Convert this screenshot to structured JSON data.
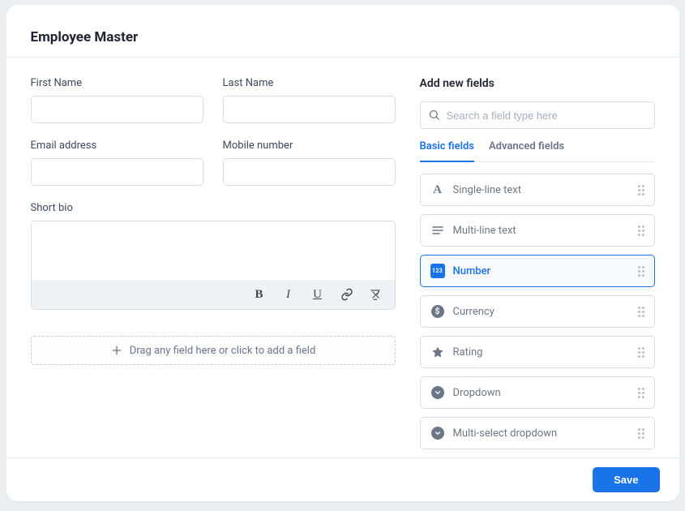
{
  "header": {
    "title": "Employee Master"
  },
  "form": {
    "first_name": {
      "label": "First Name"
    },
    "last_name": {
      "label": "Last Name"
    },
    "email": {
      "label": "Email address"
    },
    "mobile": {
      "label": "Mobile number"
    },
    "bio": {
      "label": "Short bio"
    },
    "dropzone": "Drag any field here or click to add a field"
  },
  "sidebar": {
    "title": "Add new fields",
    "search_placeholder": "Search a field type here",
    "tabs": {
      "basic": "Basic fields",
      "advanced": "Advanced fields"
    },
    "fields": {
      "single_line": "Single-line text",
      "multi_line": "Multi-line text",
      "number": "Number",
      "currency": "Currency",
      "rating": "Rating",
      "dropdown": "Dropdown",
      "multi_select": "Multi-select dropdown"
    }
  },
  "footer": {
    "save": "Save"
  }
}
